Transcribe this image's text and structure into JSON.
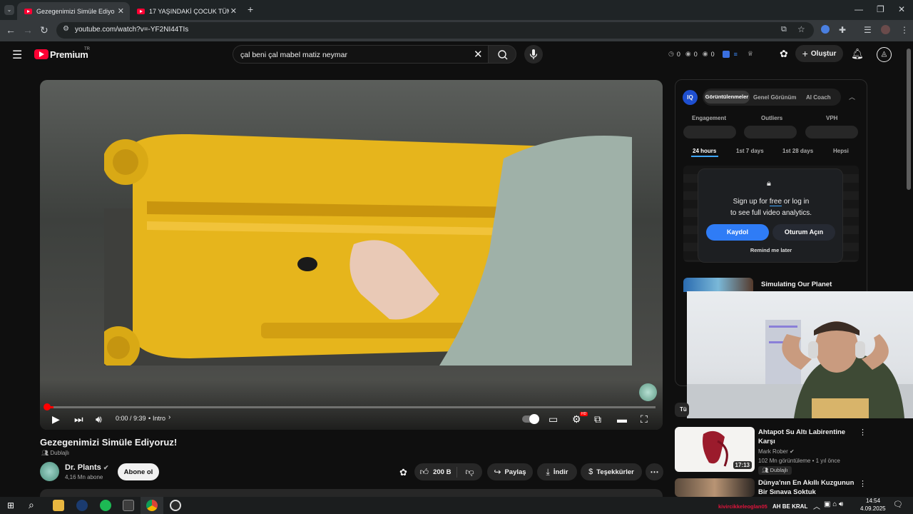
{
  "browser": {
    "tabs": [
      {
        "title": "Gezegenimizi Simüle Ediyoruz!",
        "active": true
      },
      {
        "title": "17 YAŞINDAKİ ÇOCUK TÜM MU",
        "active": false
      }
    ],
    "new_tab": "+",
    "url": "youtube.com/watch?v=-YF2NI44TIs"
  },
  "masthead": {
    "logo_text": "Premium",
    "logo_region": "TR",
    "search_value": "çal beni çal mabel matiz neymar",
    "stats": [
      "0",
      "0",
      "0"
    ],
    "create_label": "Oluştur"
  },
  "player": {
    "time": "0:00 / 9:39",
    "chapter": "Intro",
    "hd_badge": "HD",
    "progress": 0.01
  },
  "video": {
    "title": "Gezegenimizi Simüle Ediyoruz!",
    "dub_label": "Dublajlı",
    "channel": "Dr. Plants",
    "subscribers": "4,16 Mn abone",
    "subscribe_label": "Abone ol",
    "likes": "200 B",
    "share_label": "Paylaş",
    "download_label": "İndir",
    "thanks_label": "Teşekkürler"
  },
  "analytics": {
    "badge": "IQ",
    "tabs": [
      "Görüntülenmeler",
      "Genel Görünüm",
      "AI Coach"
    ],
    "metrics": [
      "Engagement",
      "Outliers",
      "VPH"
    ],
    "ranges": [
      "24 hours",
      "1st 7 days",
      "1st 28 days",
      "Hepsi"
    ],
    "lock_line1_pre": "Sign up for ",
    "lock_line1_link": "free",
    "lock_line1_post": " or log in",
    "lock_line2": "to see full video analytics.",
    "signup_label": "Kaydol",
    "login_label": "Oturum Açın",
    "remind_label": "Remind me later"
  },
  "recommendations": [
    {
      "title": "Simulating Our Planet"
    },
    {
      "title_line1": "Ahtapot Su Altı Labirentine",
      "title_line2": "Karşı",
      "channel": "Mark Rober",
      "meta": "102 Mn görüntüleme • 1 yıl önce",
      "badge": "Dublajlı",
      "duration": "17:13"
    },
    {
      "title_line1": "Dünya'nın En Akıllı Kuzgunun",
      "title_line2": "Bir Sınava Soktuk"
    }
  ],
  "chip_fragment": "Tü",
  "taskbar": {
    "ticker_name": "kivircikkeleoglan05",
    "ticker_text": "AH BE KRAL",
    "time": "14:54",
    "date": "4.09.2025"
  },
  "colors": {
    "accent": "#ff0033",
    "link_blue": "#3ea6ff",
    "button_blue": "#2f7cf6"
  }
}
